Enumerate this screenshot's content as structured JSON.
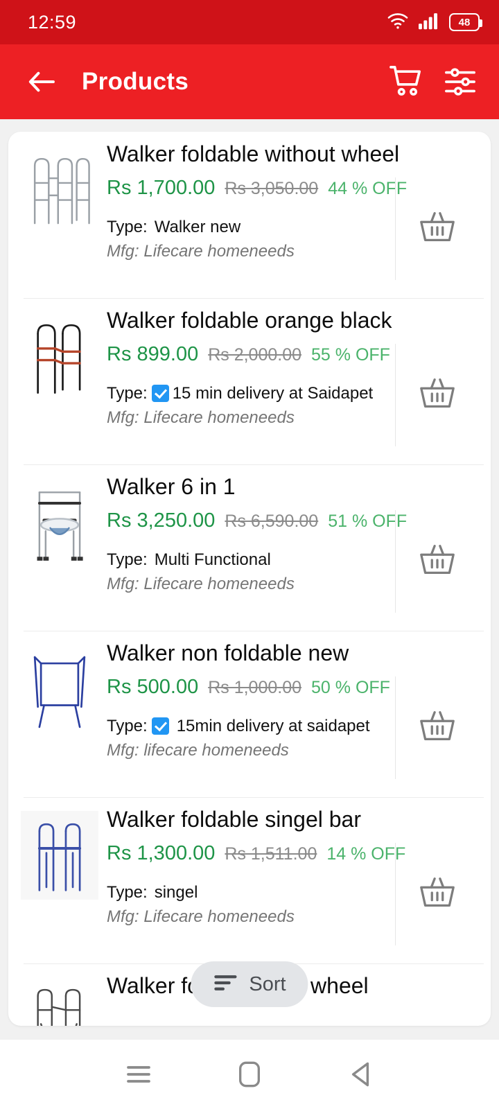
{
  "status_bar": {
    "time": "12:59",
    "battery_level": "48",
    "wifi_icon": "wifi-icon",
    "signal_icon": "cellular-signal-icon",
    "battery_icon": "battery-icon",
    "background_color": "#cf1218"
  },
  "app_bar": {
    "title": "Products",
    "back_icon": "back-arrow-icon",
    "cart_icon": "shopping-cart-icon",
    "filter_icon": "filter-sliders-icon",
    "background_color": "#ed2024"
  },
  "theme": {
    "accent_red": "#ed2024",
    "price_green": "#1e9447",
    "discount_green": "#4bb36b",
    "mrp_grey": "#8b8b8b",
    "page_background": "#f1f1f1"
  },
  "products": [
    {
      "title": "Walker foldable without wheel",
      "price": "Rs 1,700.00",
      "mrp": "Rs 3,050.00",
      "discount": "44 % OFF",
      "type_label": "Type:",
      "type_value": "Walker new",
      "has_check_badge": false,
      "mfg": "Mfg: Lifecare homeneeds",
      "cart_icon": "basket-icon",
      "thumb_icon": "walker-foldable-grey-thumbnail"
    },
    {
      "title": "Walker foldable orange black",
      "price": "Rs 899.00",
      "mrp": "Rs 2,000.00",
      "discount": "55 % OFF",
      "type_label": "Type:",
      "type_value": "15 min delivery at Saidapet",
      "has_check_badge": true,
      "mfg": "Mfg: Lifecare homeneeds",
      "cart_icon": "basket-icon",
      "thumb_icon": "walker-orange-black-thumbnail"
    },
    {
      "title": "Walker 6 in 1",
      "price": "Rs 3,250.00",
      "mrp": "Rs 6,590.00",
      "discount": "51 % OFF",
      "type_label": "Type:",
      "type_value": "Multi Functional",
      "has_check_badge": false,
      "mfg": "Mfg: Lifecare homeneeds",
      "cart_icon": "basket-icon",
      "thumb_icon": "walker-commode-chair-thumbnail"
    },
    {
      "title": "Walker non foldable new",
      "price": "Rs 500.00",
      "mrp": "Rs 1,000.00",
      "discount": "50 % OFF",
      "type_label": "Type:",
      "type_value": "15min delivery at saidapet",
      "has_check_badge": true,
      "mfg": "Mfg: lifecare homeneeds",
      "cart_icon": "basket-icon",
      "thumb_icon": "walker-non-foldable-blue-thumbnail"
    },
    {
      "title": "Walker foldable singel bar",
      "price": "Rs 1,300.00",
      "mrp": "Rs 1,511.00",
      "discount": "14 % OFF",
      "type_label": "Type:",
      "type_value": "singel",
      "has_check_badge": false,
      "mfg": "Mfg: Lifecare homeneeds",
      "cart_icon": "basket-icon",
      "thumb_icon": "walker-singel-bar-blue-thumbnail"
    },
    {
      "title": "Walker foldable with wheel",
      "price": "",
      "mrp": "",
      "discount": "",
      "type_label": "",
      "type_value": "",
      "has_check_badge": false,
      "mfg": "",
      "cart_icon": "basket-icon",
      "thumb_icon": "walker-with-wheel-thumbnail"
    }
  ],
  "sort_fab": {
    "label": "Sort",
    "icon": "sort-lines-icon",
    "background_color": "#e3e5e8"
  },
  "nav_bar": {
    "recents_icon": "recents-menu-icon",
    "home_icon": "home-square-icon",
    "back_icon": "back-triangle-icon"
  }
}
